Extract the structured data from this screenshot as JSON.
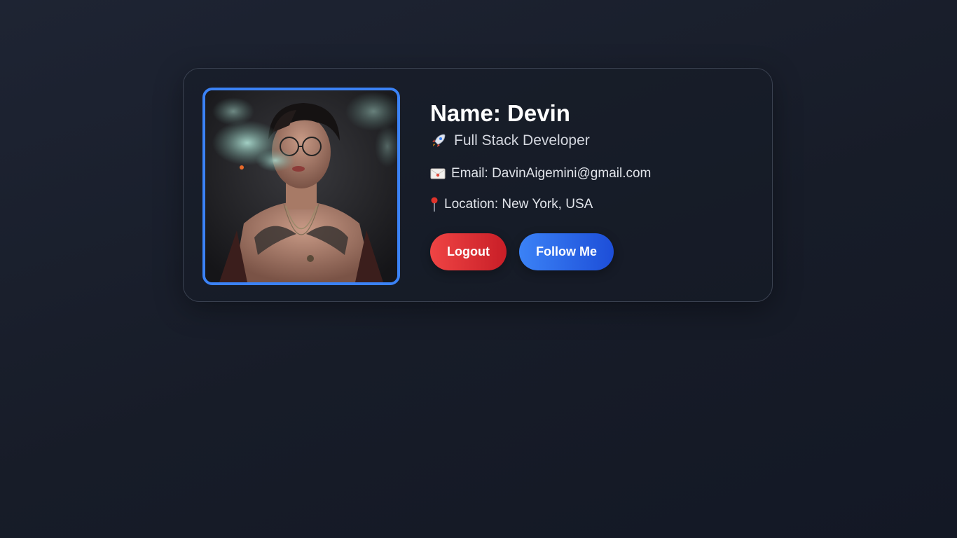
{
  "profile": {
    "name": "Name: Devin",
    "role": "Full Stack Developer",
    "role_icon": "rocket-icon",
    "email": "Email: DavinAigemini@gmail.com",
    "email_icon": "envelope-icon",
    "location": "Location: New York, USA",
    "location_icon": "pin-icon",
    "avatar": "profile-photo"
  },
  "actions": {
    "logout_label": "Logout",
    "follow_label": "Follow Me"
  },
  "colors": {
    "accent_blue": "#3b82f6",
    "logout_red": "#ef4444",
    "background": "#1b2130"
  }
}
